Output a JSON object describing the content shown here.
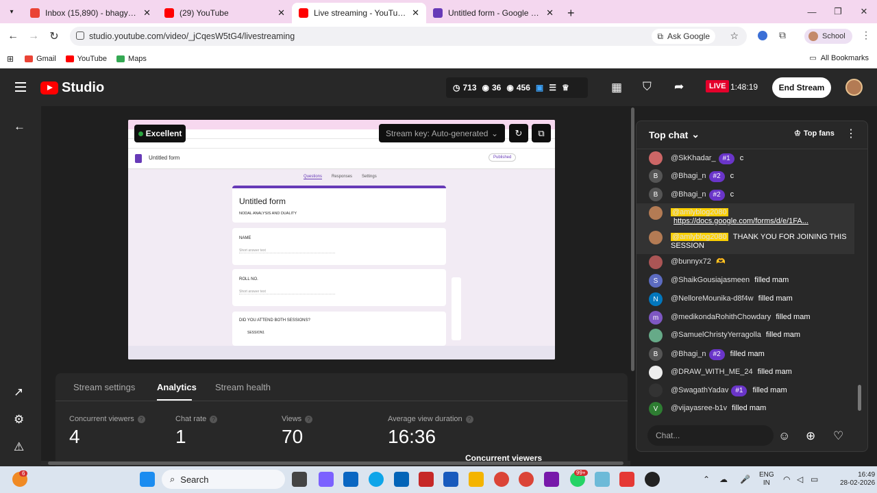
{
  "browser": {
    "tabs": [
      {
        "label": "Inbox (15,890) - bhagya.eee@n",
        "color": "#ea4335"
      },
      {
        "label": "(29) YouTube",
        "color": "#ff0000"
      },
      {
        "label": "Live streaming - YouTube Studi",
        "color": "#ff0000",
        "active": true
      },
      {
        "label": "Untitled form - Google Forms",
        "color": "#673ab7"
      }
    ],
    "url": "studio.youtube.com/video/_jCqesW5tG4/livestreaming",
    "ask_google": "Ask Google",
    "profile": "School",
    "bookmarks": [
      "Gmail",
      "YouTube",
      "Maps"
    ],
    "all_bookmarks": "All Bookmarks"
  },
  "studio": {
    "logo": "Studio",
    "stats": {
      "a": "713",
      "b": "36",
      "c": "456"
    },
    "live_badge": "LIVE",
    "live_time": "1:48:19",
    "end_stream": "End Stream"
  },
  "preview": {
    "status": "Excellent",
    "stream_key": "Stream key: Auto-generated",
    "form_title": "Untitled form",
    "form_desc": "NODAL ANALYSIS AND DUALITY",
    "q1": "NAME",
    "q2": "ROLL NO.",
    "q3": "DID YOU ATTEND BOTH SESSIONS?",
    "q3_opt": "SESSION1",
    "short_answer": "Short answer text",
    "tabs": [
      "Questions",
      "Responses",
      "Settings"
    ],
    "published": "Published"
  },
  "analytics": {
    "tabs": [
      "Stream settings",
      "Analytics",
      "Stream health"
    ],
    "metrics": [
      {
        "label": "Concurrent viewers",
        "value": "4"
      },
      {
        "label": "Chat rate",
        "value": "1"
      },
      {
        "label": "Views",
        "value": "70"
      },
      {
        "label": "Average view duration",
        "value": "16:36"
      }
    ],
    "chart_title": "Concurrent viewers"
  },
  "chat": {
    "header": "Top chat",
    "top_fans": "Top fans",
    "input_placeholder": "Chat...",
    "messages": [
      {
        "author": "@SkKhadar_",
        "badge": "#1",
        "text": "c",
        "avatar": "",
        "color": "#c66"
      },
      {
        "author": "@Bhagi_n",
        "badge": "#2",
        "text": "c",
        "avatar": "B",
        "color": "#555"
      },
      {
        "author": "@Bhagi_n",
        "badge": "#2",
        "text": "c",
        "avatar": "B",
        "color": "#555"
      },
      {
        "author": "@amlyblog2080",
        "badge": "",
        "text": "https://docs.google.com/forms/d/e/1FA...",
        "avatar": "",
        "color": "#b37b54",
        "highlight": true,
        "link": true
      },
      {
        "author": "@amlyblog2080",
        "badge": "",
        "text": "THANK YOU FOR JOINING THIS SESSION",
        "avatar": "",
        "color": "#b37b54",
        "highlight": true
      },
      {
        "author": "@bunnyx72",
        "badge": "",
        "text": "🫶",
        "avatar": "",
        "color": "#a55"
      },
      {
        "author": "@ShaikGousiajasmeen",
        "badge": "",
        "text": "filled mam",
        "avatar": "S",
        "color": "#5c6bc0"
      },
      {
        "author": "@NelloreMounika-d8f4w",
        "badge": "",
        "text": "filled mam",
        "avatar": "N",
        "color": "#0277bd"
      },
      {
        "author": "@medikondaRohithChowdary",
        "badge": "",
        "text": "filled mam",
        "avatar": "m",
        "color": "#7e57c2"
      },
      {
        "author": "@SamuelChristyYerragolla",
        "badge": "",
        "text": "filled mam",
        "avatar": "",
        "color": "#6a8"
      },
      {
        "author": "@Bhagi_n",
        "badge": "#2",
        "text": "filled mam",
        "avatar": "B",
        "color": "#555"
      },
      {
        "author": "@DRAW_WITH_ME_24",
        "badge": "",
        "text": "filled mam",
        "avatar": "",
        "color": "#eee"
      },
      {
        "author": "@SwagathYadav",
        "badge": "#1",
        "text": "filled mam",
        "avatar": "",
        "color": "#333"
      },
      {
        "author": "@vijayasree-b1v",
        "badge": "",
        "text": "filled mam",
        "avatar": "V",
        "color": "#2e7d32"
      }
    ]
  },
  "taskbar": {
    "search": "Search",
    "lang1": "ENG",
    "lang2": "IN",
    "time": "16:49",
    "date": "28-02-2026",
    "badge_count": "99+",
    "notif": "6"
  }
}
